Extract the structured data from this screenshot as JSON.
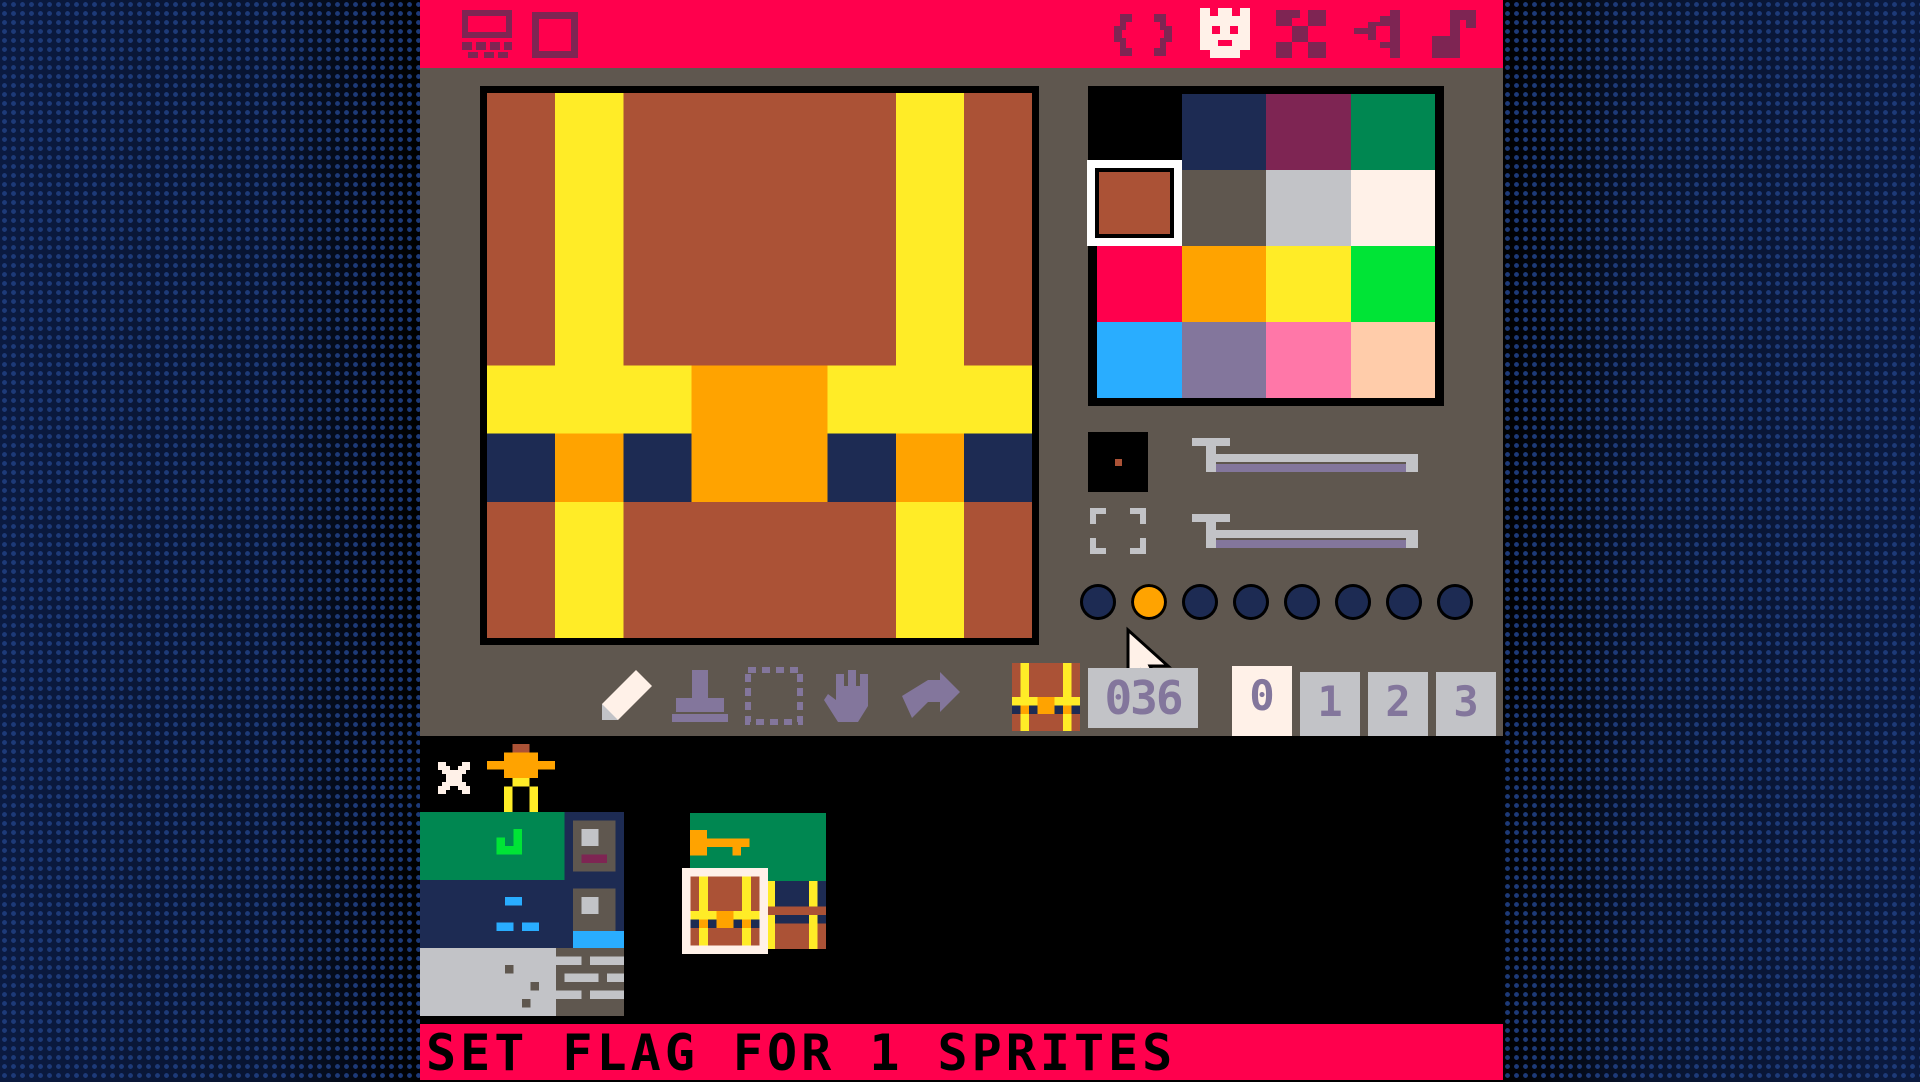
{
  "colors": {
    "accent": "#ff004d",
    "panel": "#5f574f",
    "palette": [
      "#000000",
      "#1d2b53",
      "#7e2553",
      "#008751",
      "#ab5236",
      "#5f574f",
      "#c2c3c7",
      "#fff1e8",
      "#ff004d",
      "#ffa300",
      "#ffec27",
      "#00e436",
      "#29adff",
      "#83769c",
      "#ff77a8",
      "#ffccaa"
    ]
  },
  "topbar": {
    "left_icons": [
      "sprite-editor-icon",
      "map-editor-icon"
    ],
    "right_icons": [
      "code-editor-icon",
      "sprite-mode-icon",
      "map-mode-icon",
      "sfx-editor-icon",
      "music-editor-icon"
    ]
  },
  "palette": {
    "selected_index": 4
  },
  "sprite_editor": {
    "sprite_number": "036",
    "flags": [
      false,
      true,
      false,
      false,
      false,
      false,
      false,
      false
    ],
    "tools": [
      "pencil-icon",
      "stamp-icon",
      "select-icon",
      "pan-icon",
      "fill-icon"
    ],
    "tabs": [
      "0",
      "1",
      "2",
      "3"
    ],
    "active_tab": 0,
    "brush_size_icon": "brush-size-icon",
    "zoom_icon": "zoom-icon"
  },
  "sheet": {
    "cursor_icon": "close-icon",
    "player_icon": "player-sprite-icon"
  },
  "status": {
    "text": "SET FLAG FOR 1 SPRITES"
  }
}
